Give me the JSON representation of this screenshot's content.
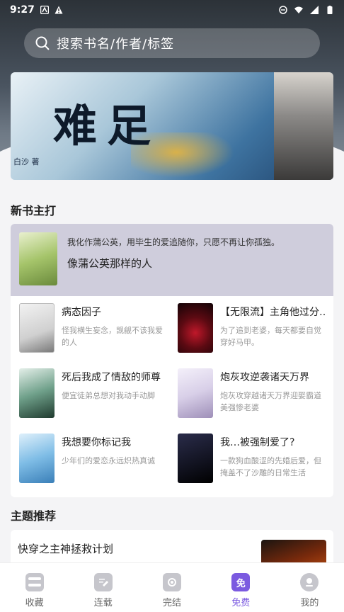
{
  "status": {
    "time": "9:27"
  },
  "search": {
    "placeholder": "搜索书名/作者/标签"
  },
  "banner": {
    "title": "难足",
    "author_text": "白沙 著"
  },
  "new_books": {
    "title": "新书主打",
    "featured": {
      "description": "我化作蒲公英，用毕生的爱追随你，只愿不再让你孤独。",
      "name": "像蒲公英那样的人"
    },
    "items": [
      {
        "title": "病态因子",
        "desc": "怪我横生妄念，觊觎不该我爱的人"
      },
      {
        "title": "【无限流】主角他过分…",
        "desc": "为了追到老婆，每天都要自觉穿好马甲。"
      },
      {
        "title": "死后我成了情敌的师尊",
        "desc": "便宜徒弟总想对我动手动脚"
      },
      {
        "title": "炮灰攻逆袭诸天万界",
        "desc": "炮灰攻穿越诸天万界迎娶霸道美强惨老婆"
      },
      {
        "title": "我想要你标记我",
        "desc": "少年们的爱恋永远炽热真诚"
      },
      {
        "title": "我…被强制爱了?",
        "desc": "一款狗血酸涩的先婚后爱，但掩盖不了沙雕的日常生活"
      }
    ]
  },
  "theme": {
    "title": "主题推荐",
    "card_title": "快穿之主神拯救计划"
  },
  "tabs": [
    {
      "label": "收藏",
      "icon": "shelf-icon"
    },
    {
      "label": "连载",
      "icon": "book-edit-icon"
    },
    {
      "label": "完结",
      "icon": "completed-icon"
    },
    {
      "label": "免费",
      "icon": "free-icon",
      "badge": "免"
    },
    {
      "label": "我的",
      "icon": "profile-icon"
    }
  ],
  "colors": {
    "accent": "#7b5ae0",
    "featured_bg": "#cfcddc"
  }
}
